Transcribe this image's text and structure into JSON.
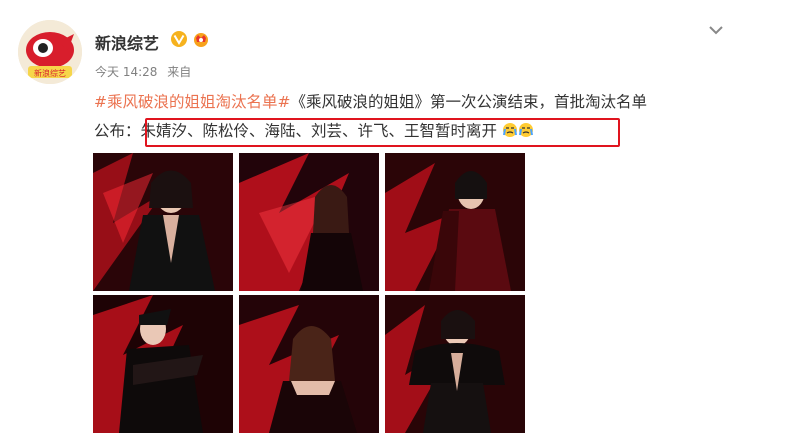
{
  "account": {
    "name": "新浪综艺",
    "avatar_text": "新浪综艺",
    "verified_icon": "verified-v-icon",
    "member_icon": "member-crown-icon"
  },
  "post": {
    "time": "今天 14:28",
    "source": "来自",
    "hashtag": "#乘风破浪的姐姐淘汰名单#",
    "text_part1": "《乘风破浪的姐姐》第一次公演结束，首批淘汰名单",
    "text_prefix": "公布：",
    "highlighted_names": "朱婧汐、陈松伶、海陆、刘芸、许飞、王智暂时离开"
  },
  "images": {
    "count": 6,
    "items": [
      {
        "alt": "contestant-photo-1"
      },
      {
        "alt": "contestant-photo-2"
      },
      {
        "alt": "contestant-photo-3"
      },
      {
        "alt": "contestant-photo-4"
      },
      {
        "alt": "contestant-photo-5"
      },
      {
        "alt": "contestant-photo-6"
      }
    ]
  },
  "colors": {
    "hashtag": "#eb7350",
    "highlight_border": "#e0141e",
    "verified": "#f6b21e"
  }
}
